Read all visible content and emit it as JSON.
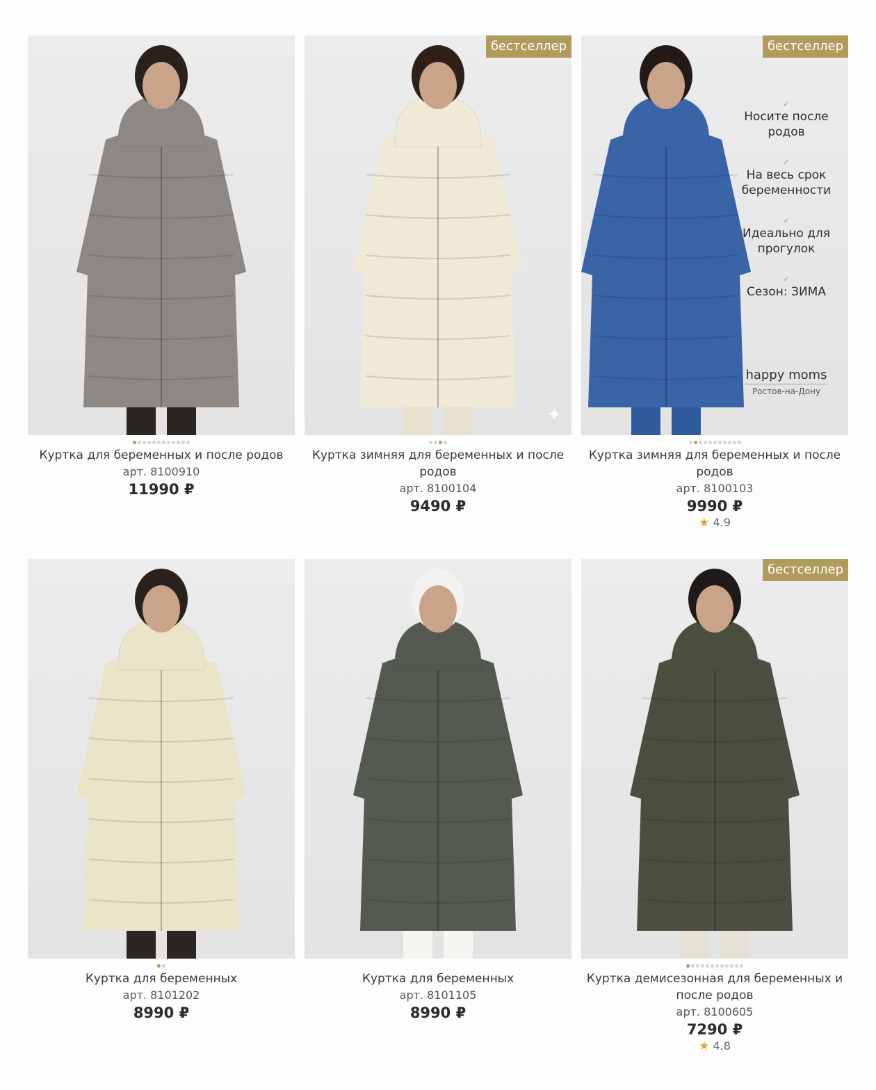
{
  "products": [
    {
      "name": "Куртка для беременных и после родов",
      "sku": "арт. 8100910",
      "price": "11990 ₽",
      "badge": "",
      "dots_total": 12,
      "dot_active": 0,
      "coat_color": "#8e8885",
      "hair_color": "#2a211d",
      "pants_color": "#2c2622",
      "features": [],
      "rating": ""
    },
    {
      "name": "Куртка зимняя для беременных и после родов",
      "sku": "арт. 8100104",
      "price": "9490 ₽",
      "badge": "бестселлер",
      "dots_total": 4,
      "dot_active": 2,
      "coat_color": "#efe9d6",
      "hair_color": "#2e1f17",
      "pants_color": "#e8dfcc",
      "features": [],
      "rating": ""
    },
    {
      "name": "Куртка зимняя для беременных и после родов",
      "sku": "арт. 8100103",
      "price": "9990 ₽",
      "badge": "бестселлер",
      "dots_total": 11,
      "dot_active": 1,
      "coat_color": "#3a64a8",
      "hair_color": "#231a16",
      "pants_color": "#2f5c9c",
      "features": [
        "Носите после родов",
        "На весь срок беременности",
        "Идеально для прогулок",
        "Сезон: ЗИМА"
      ],
      "brand": "happy moms",
      "city": "Ростов-на-Дону",
      "rating": "4.9"
    },
    {
      "name": "Куртка для беременных",
      "sku": "арт. 8101202",
      "price": "8990 ₽",
      "badge": "",
      "dots_total": 2,
      "dot_active": 0,
      "coat_color": "#ece4c8",
      "hair_color": "#2a211d",
      "pants_color": "#2c2622",
      "features": [],
      "rating": ""
    },
    {
      "name": "Куртка для беременных",
      "sku": "арт. 8101105",
      "price": "8990 ₽",
      "badge": "",
      "dots_total": 0,
      "dot_active": 0,
      "coat_color": "#545a4f",
      "hair_color": "#f4f2ee",
      "pants_color": "#f5f5f2",
      "features": [],
      "rating": ""
    },
    {
      "name": "Куртка демисезонная для беременных и после родов",
      "sku": "арт. 8100605",
      "price": "7290 ₽",
      "badge": "бестселлер",
      "dots_total": 12,
      "dot_active": 0,
      "coat_color": "#4b4f3f",
      "hair_color": "#1f1a17",
      "pants_color": "#e6e0d4",
      "features": [],
      "rating": "4.8"
    }
  ]
}
